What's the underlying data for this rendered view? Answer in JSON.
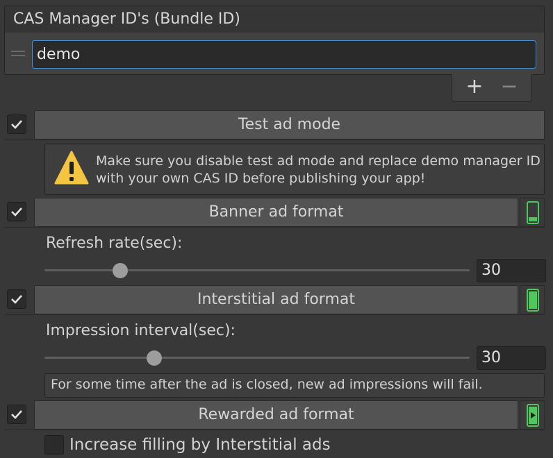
{
  "managers": {
    "title": "CAS Manager ID's (Bundle ID)",
    "items": [
      "demo"
    ],
    "add_symbol": "+",
    "remove_symbol": "−"
  },
  "test_mode": {
    "label": "Test ad mode",
    "checked": true,
    "warning": "Make sure you disable test ad mode and replace demo manager ID with your own CAS ID before publishing your app!"
  },
  "banner": {
    "label": "Banner ad format",
    "checked": true,
    "refresh_label": "Refresh rate(sec):",
    "refresh_value": "30",
    "icon": "phone-banner-icon"
  },
  "interstitial": {
    "label": "Interstitial ad format",
    "checked": true,
    "interval_label": "Impression interval(sec):",
    "interval_value": "30",
    "note": "For some time after the ad is closed, new ad impressions will fail.",
    "icon": "phone-fullscreen-icon"
  },
  "rewarded": {
    "label": "Rewarded ad format",
    "checked": true,
    "icon": "phone-play-icon",
    "increase_filling_label": "Increase filling by Interstitial ads",
    "increase_filling_checked": false
  },
  "colors": {
    "background": "#383838",
    "accent_focus": "#3d8fe0",
    "status_green": "#4ec85a",
    "warning_yellow": "#f4c542"
  }
}
